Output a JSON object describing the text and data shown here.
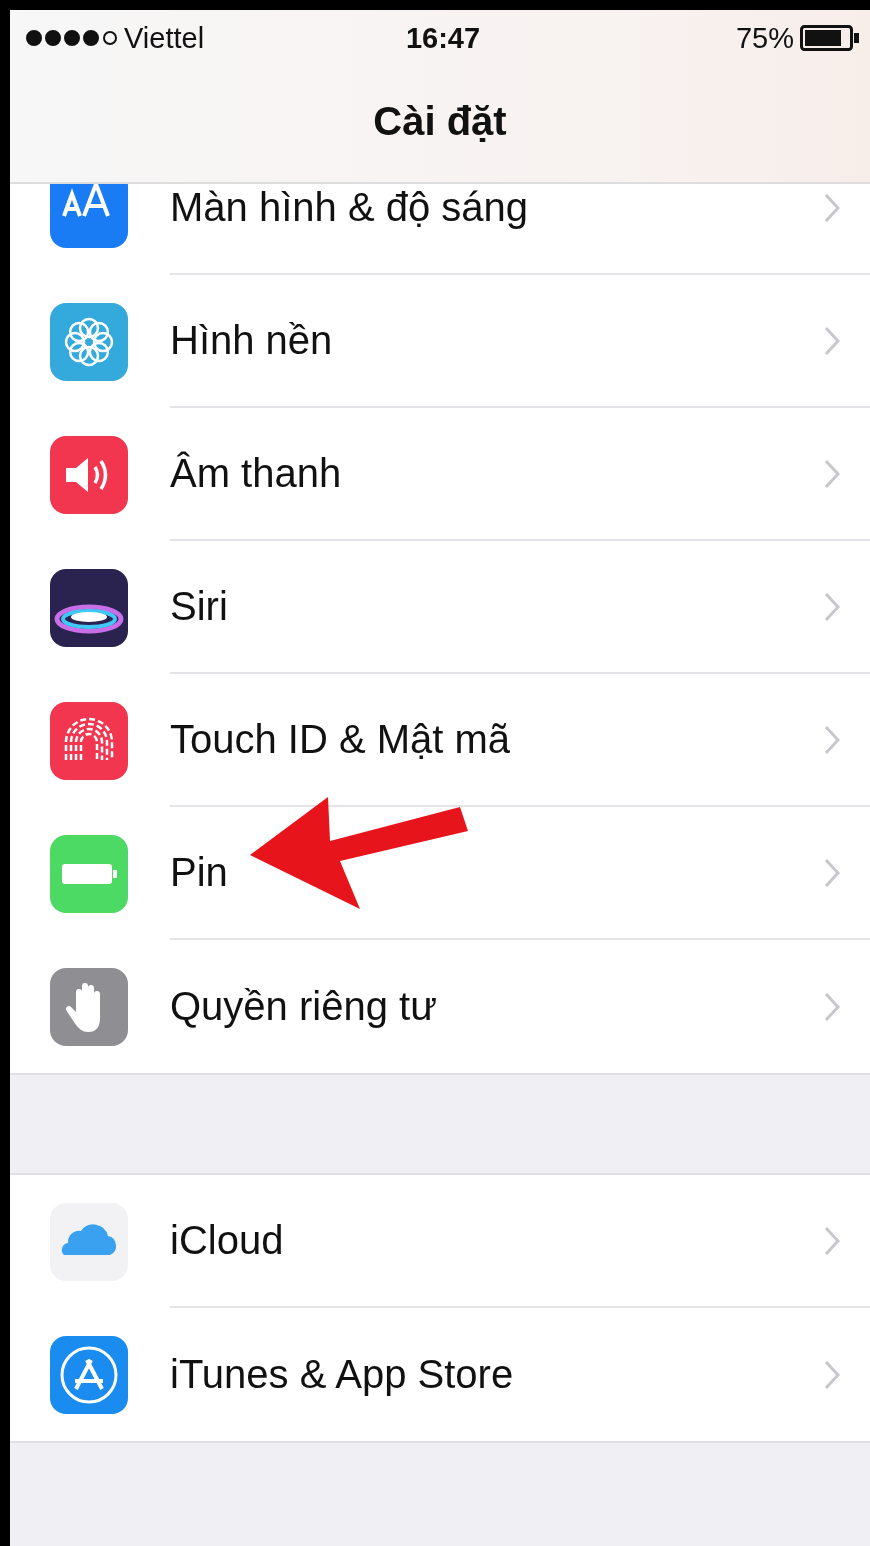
{
  "status_bar": {
    "carrier": "Viettel",
    "time": "16:47",
    "battery": "75%"
  },
  "nav": {
    "title": "Cài đặt"
  },
  "groups": [
    {
      "items": [
        {
          "label": "Màn hình & độ sáng",
          "color": "#1a7cf5"
        },
        {
          "label": "Hình nền",
          "color": "#34aadc"
        },
        {
          "label": "Âm thanh",
          "color": "#f2364f"
        },
        {
          "label": "Siri",
          "color": "#2a2350"
        },
        {
          "label": "Touch ID & Mật mã",
          "color": "#f2364f"
        },
        {
          "label": "Pin",
          "color": "#4cd964",
          "annotated": true
        },
        {
          "label": "Quyền riêng tư",
          "color": "#8e8e93"
        }
      ]
    },
    {
      "items": [
        {
          "label": "iCloud",
          "color": "#f2f2f5"
        },
        {
          "label": "iTunes & App Store",
          "color": "#1a8cf0"
        }
      ]
    }
  ]
}
